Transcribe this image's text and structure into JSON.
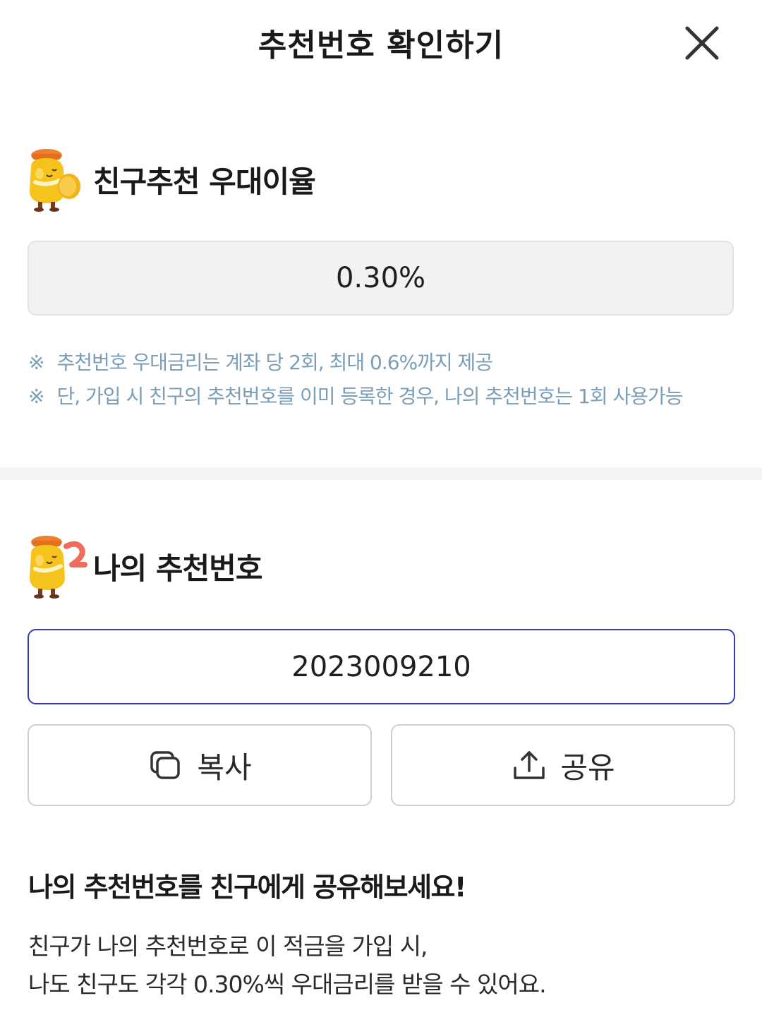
{
  "header": {
    "title": "추천번호 확인하기",
    "close_icon": "close-icon"
  },
  "rate_section": {
    "icon": "character-coin-icon",
    "title": "친구추천 우대이율",
    "value": "0.30%",
    "notes": [
      {
        "mark": "※",
        "text": "추천번호 우대금리는 계좌 당 2회, 최대 0.6%까지 제공"
      },
      {
        "mark": "※",
        "text": "단, 가입 시 친구의 추천번호를 이미 등록한 경우, 나의 추천번호는 1회 사용가능"
      }
    ]
  },
  "code_section": {
    "icon": "character-number-icon",
    "title": "나의 추천번호",
    "code": "2023009210",
    "copy_button": {
      "label": "복사",
      "icon": "copy-icon"
    },
    "share_button": {
      "label": "공유",
      "icon": "share-icon"
    }
  },
  "info": {
    "heading": "나의 추천번호를 친구에게 공유해보세요!",
    "lines": [
      "친구가 나의 추천번호로 이 적금을 가입 시,",
      "나도 친구도 각각 0.30%씩 우대금리를 받을 수 있어요."
    ]
  },
  "colors": {
    "note": "#7a9db8",
    "focus_border": "#3a3ab8",
    "character_yellow": "#f6c21c",
    "character_hat": "#ef7f2c"
  }
}
